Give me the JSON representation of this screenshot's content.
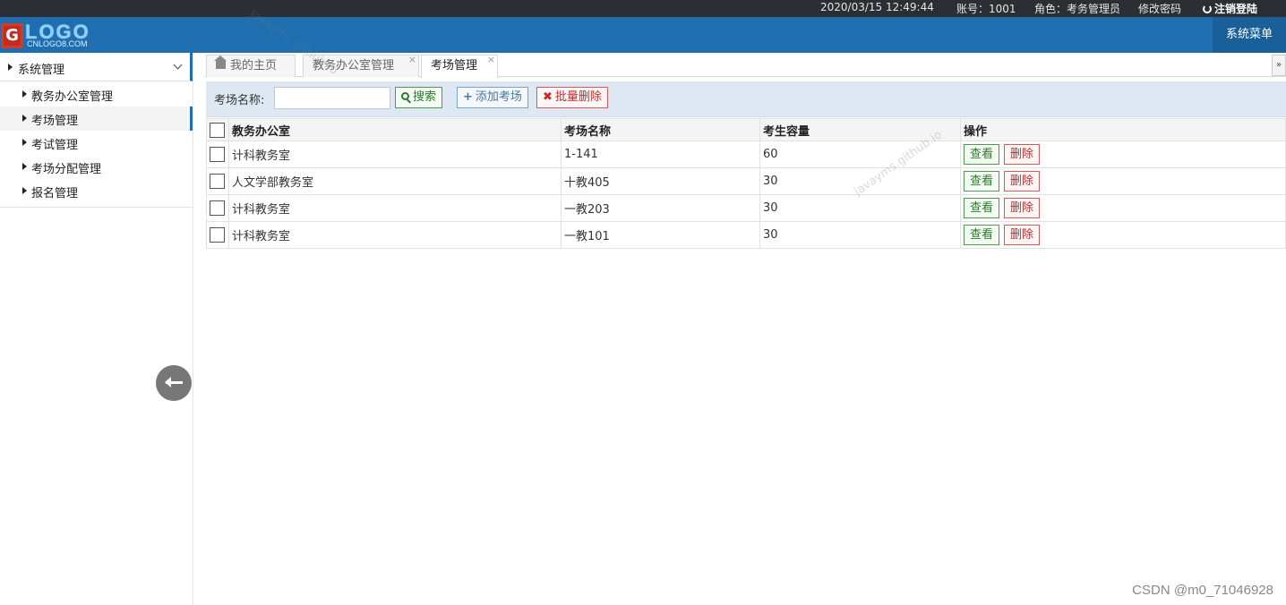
{
  "topbar": {
    "datetime": "2020/03/15 12:49:44",
    "account": "账号：1001",
    "role": "角色：考务管理员",
    "change_password": "修改密码",
    "logout": "注销登陆"
  },
  "header": {
    "logo_text": "LOGO",
    "logo_sub": "CNLOGO8.COM",
    "system_menu": "系统菜单"
  },
  "sidebar": {
    "group_label": "系统管理",
    "items": [
      {
        "label": "教务办公室管理",
        "active": false
      },
      {
        "label": "考场管理",
        "active": true
      },
      {
        "label": "考试管理",
        "active": false
      },
      {
        "label": "考场分配管理",
        "active": false
      },
      {
        "label": "报名管理",
        "active": false
      }
    ]
  },
  "tabs": [
    {
      "label": "我的主页",
      "icon": "home-icon",
      "closable": false
    },
    {
      "label": "教务办公室管理",
      "closable": true
    },
    {
      "label": "考场管理",
      "closable": true,
      "active": true
    }
  ],
  "toolbar": {
    "field_label": "考场名称:",
    "search_value": "",
    "search_button": "搜索",
    "add_button": "添加考场",
    "batch_delete_button": "批量删除"
  },
  "table": {
    "headers": [
      "教务办公室",
      "考场名称",
      "考生容量",
      "操作"
    ],
    "rows": [
      {
        "office": "计科教务室",
        "name": "1-141",
        "capacity": "60"
      },
      {
        "office": "人文学部教务室",
        "name": "十教405",
        "capacity": "30"
      },
      {
        "office": "计科教务室",
        "name": "一教203",
        "capacity": "30"
      },
      {
        "office": "计科教务室",
        "name": "一教101",
        "capacity": "30"
      }
    ],
    "view_label": "查看",
    "delete_label": "删除"
  },
  "watermarks": {
    "text": "javayms.github.io"
  },
  "footer": {
    "csdn": "CSDN @m0_71046928"
  },
  "colors": {
    "header_blue": "#1f6fb0",
    "topbar_dark": "#2b2f33",
    "toolbar_bg": "#dde8f3",
    "view_green": "#2d7a2d",
    "delete_red": "#c22b2b"
  }
}
